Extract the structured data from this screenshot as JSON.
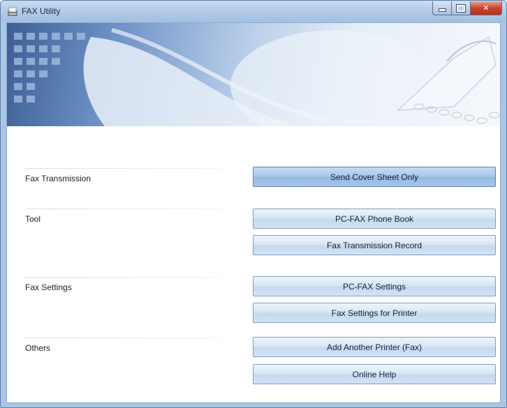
{
  "window": {
    "title": "FAX Utility",
    "icon": "fax-app-icon"
  },
  "sections": {
    "fax_transmission": {
      "label": "Fax Transmission",
      "buttons": [
        "Send Cover Sheet Only"
      ]
    },
    "tool": {
      "label": "Tool",
      "buttons": [
        "PC-FAX Phone Book",
        "Fax Transmission Record"
      ]
    },
    "fax_settings": {
      "label": "Fax Settings",
      "buttons": [
        "PC-FAX Settings",
        "Fax Settings for Printer"
      ]
    },
    "others": {
      "label": "Others",
      "buttons": [
        "Add Another Printer (Fax)",
        "Online Help"
      ]
    }
  },
  "colors": {
    "title_bar": "#b4cde9",
    "button_face": "#d6e5f4",
    "button_selected": "#a9c7ea",
    "close_button": "#c7452d"
  }
}
